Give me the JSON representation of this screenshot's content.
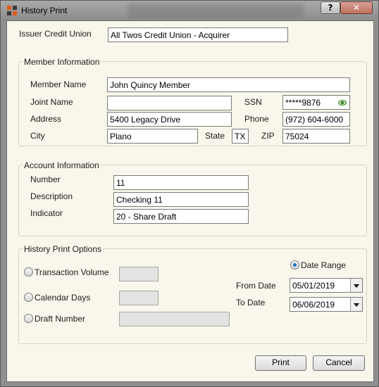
{
  "window": {
    "title": "History Print"
  },
  "issuer": {
    "label": "Issuer Credit Union",
    "value": "All Twos Credit Union - Acquirer"
  },
  "member": {
    "title": "Member Information",
    "name_label": "Member Name",
    "name": "John Quincy Member",
    "joint_label": "Joint Name",
    "joint": "",
    "ssn_label": "SSN",
    "ssn": "*****9876",
    "address_label": "Address",
    "address": "5400 Legacy Drive",
    "phone_label": "Phone",
    "phone": "(972) 604-6000",
    "city_label": "City",
    "city": "Plano",
    "state_label": "State",
    "state": "TX",
    "zip_label": "ZIP",
    "zip": "75024"
  },
  "account": {
    "title": "Account Information",
    "number_label": "Number",
    "number": "11",
    "description_label": "Description",
    "description": "Checking 11",
    "indicator_label": "Indicator",
    "indicator": "20 - Share Draft"
  },
  "options": {
    "title": "History Print Options",
    "transaction_volume_label": "Transaction Volume",
    "transaction_volume": "",
    "calendar_days_label": "Calendar Days",
    "calendar_days": "",
    "draft_number_label": "Draft Number",
    "draft_number": "",
    "date_range_label": "Date Range",
    "date_range_selected": true,
    "from_label": "From Date",
    "from_date": "05/01/2019",
    "to_label": "To Date",
    "to_date": "06/06/2019"
  },
  "buttons": {
    "print": "Print",
    "cancel": "Cancel"
  },
  "icons": {
    "app": "app-icon",
    "help": "help-icon",
    "close": "close-icon",
    "ssn": "eye-icon"
  },
  "colors": {
    "accent": "#1d6fc6",
    "close": "#c2705f",
    "background": "#f9f7eb"
  }
}
